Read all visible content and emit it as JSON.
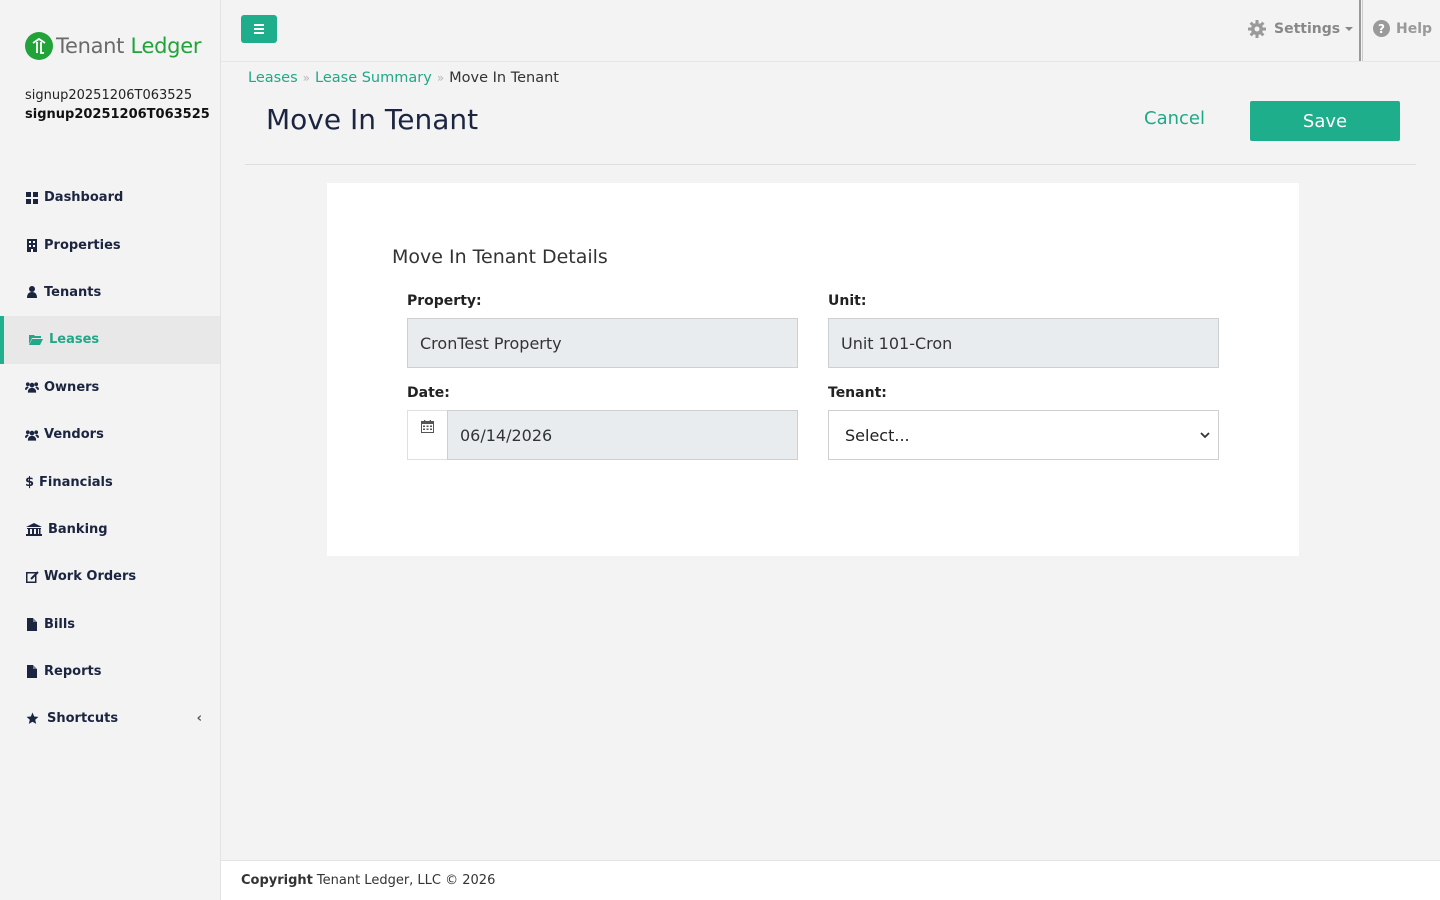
{
  "brand": {
    "word1": "Tenant",
    "word2": "Ledger",
    "color": "#22a33a"
  },
  "user": {
    "line1": "signup20251206T063525",
    "line2": "signup20251206T063525"
  },
  "sidebar": {
    "items": [
      {
        "label": "Dashboard",
        "icon": "dashboard-icon"
      },
      {
        "label": "Properties",
        "icon": "building-icon"
      },
      {
        "label": "Tenants",
        "icon": "user-icon"
      },
      {
        "label": "Leases",
        "icon": "folder-open-icon",
        "active": true
      },
      {
        "label": "Owners",
        "icon": "users-icon"
      },
      {
        "label": "Vendors",
        "icon": "users-icon"
      },
      {
        "label": "Financials",
        "icon": "dollar-icon"
      },
      {
        "label": "Banking",
        "icon": "bank-icon"
      },
      {
        "label": "Work Orders",
        "icon": "edit-icon"
      },
      {
        "label": "Bills",
        "icon": "file-icon"
      },
      {
        "label": "Reports",
        "icon": "file-icon"
      },
      {
        "label": "Shortcuts",
        "icon": "star-icon"
      }
    ]
  },
  "topbar": {
    "settings_label": "Settings",
    "help_label": "Help",
    "help_glyph": "?"
  },
  "breadcrumb": {
    "item1": "Leases",
    "item2": "Lease Summary",
    "current": "Move In Tenant"
  },
  "page": {
    "title": "Move In Tenant",
    "cancel_label": "Cancel",
    "save_label": "Save"
  },
  "form": {
    "title": "Move In Tenant Details",
    "property_label": "Property:",
    "property_value": "CronTest Property",
    "unit_label": "Unit:",
    "unit_value": "Unit 101-Cron",
    "date_label": "Date:",
    "date_value": "06/14/2026",
    "tenant_label": "Tenant:",
    "tenant_value": "Select..."
  },
  "footer": {
    "bold": "Copyright",
    "text": "Tenant Ledger, LLC © 2026"
  },
  "colors": {
    "accent": "#1fae8b",
    "link": "#20a888",
    "navy": "#1c2540"
  }
}
